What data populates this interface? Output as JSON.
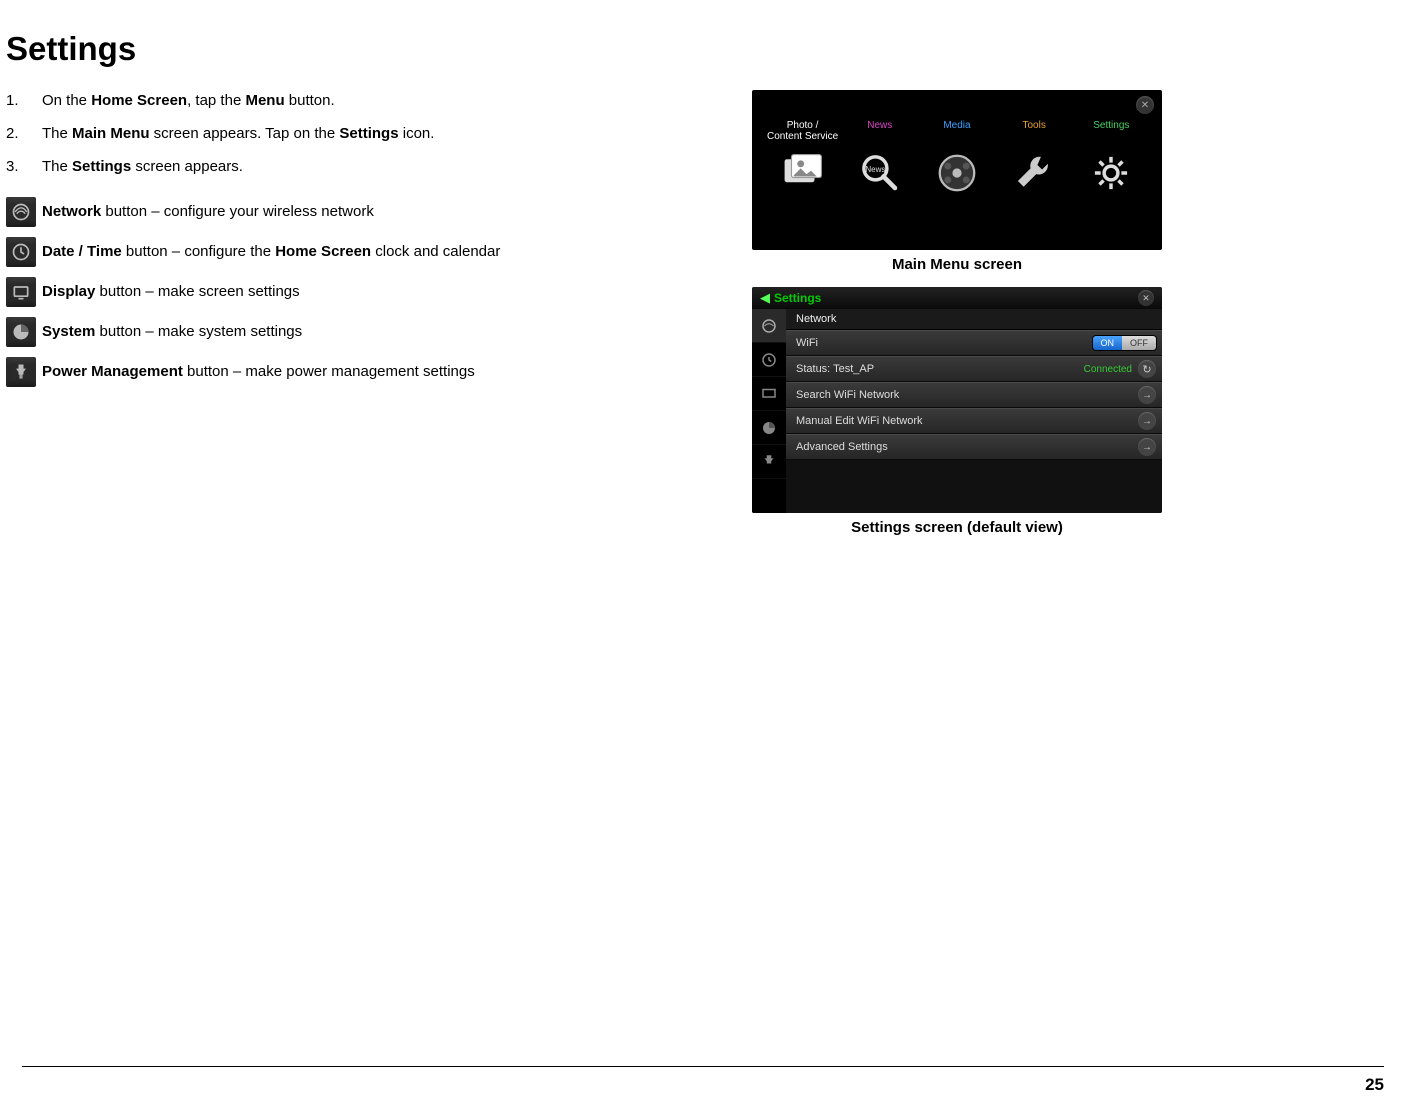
{
  "page": {
    "title": "Settings",
    "number": "25"
  },
  "steps": [
    {
      "pre": "On the ",
      "b1": "Home Screen",
      "mid": ", tap the ",
      "b2": "Menu",
      "post": " button."
    },
    {
      "pre": "The ",
      "b1": "Main Menu",
      "mid": " screen appears.  Tap on the ",
      "b2": "Settings",
      "post": " icon."
    },
    {
      "pre": "The ",
      "b1": "Settings",
      "mid": " screen appears.",
      "b2": "",
      "post": ""
    }
  ],
  "iconlines": [
    {
      "icon": "network",
      "b1": "Network",
      "mid": " button – configure your wireless network",
      "b2": "",
      "post": ""
    },
    {
      "icon": "clock",
      "b1": "Date / Time",
      "mid": " button – configure the ",
      "b2": "Home Screen",
      "post": " clock and calendar"
    },
    {
      "icon": "display",
      "b1": "Display",
      "mid": " button – make screen settings",
      "b2": "",
      "post": ""
    },
    {
      "icon": "system",
      "b1": "System",
      "mid": " button – make system settings",
      "b2": "",
      "post": ""
    },
    {
      "icon": "power",
      "b1": "Power Management",
      "mid": " button – make power management settings",
      "b2": "",
      "post": ""
    }
  ],
  "mainmenu": {
    "caption": "Main Menu screen",
    "tabs": [
      {
        "label": "Photo /\nContent Service",
        "color": "#fff"
      },
      {
        "label": "News",
        "color": "#d946c4"
      },
      {
        "label": "Media",
        "color": "#3aa0ff"
      },
      {
        "label": "Tools",
        "color": "#e8a030"
      },
      {
        "label": "Settings",
        "color": "#48d060"
      }
    ]
  },
  "settingsshot": {
    "caption": "Settings screen (default view)",
    "title": "Settings",
    "section": "Network",
    "rows": {
      "wifi": "WiFi",
      "on": "ON",
      "off": "OFF",
      "status": "Status: Test_AP",
      "connected": "Connected",
      "search": "Search WiFi Network",
      "manual": "Manual Edit WiFi Network",
      "advanced": "Advanced Settings"
    }
  }
}
